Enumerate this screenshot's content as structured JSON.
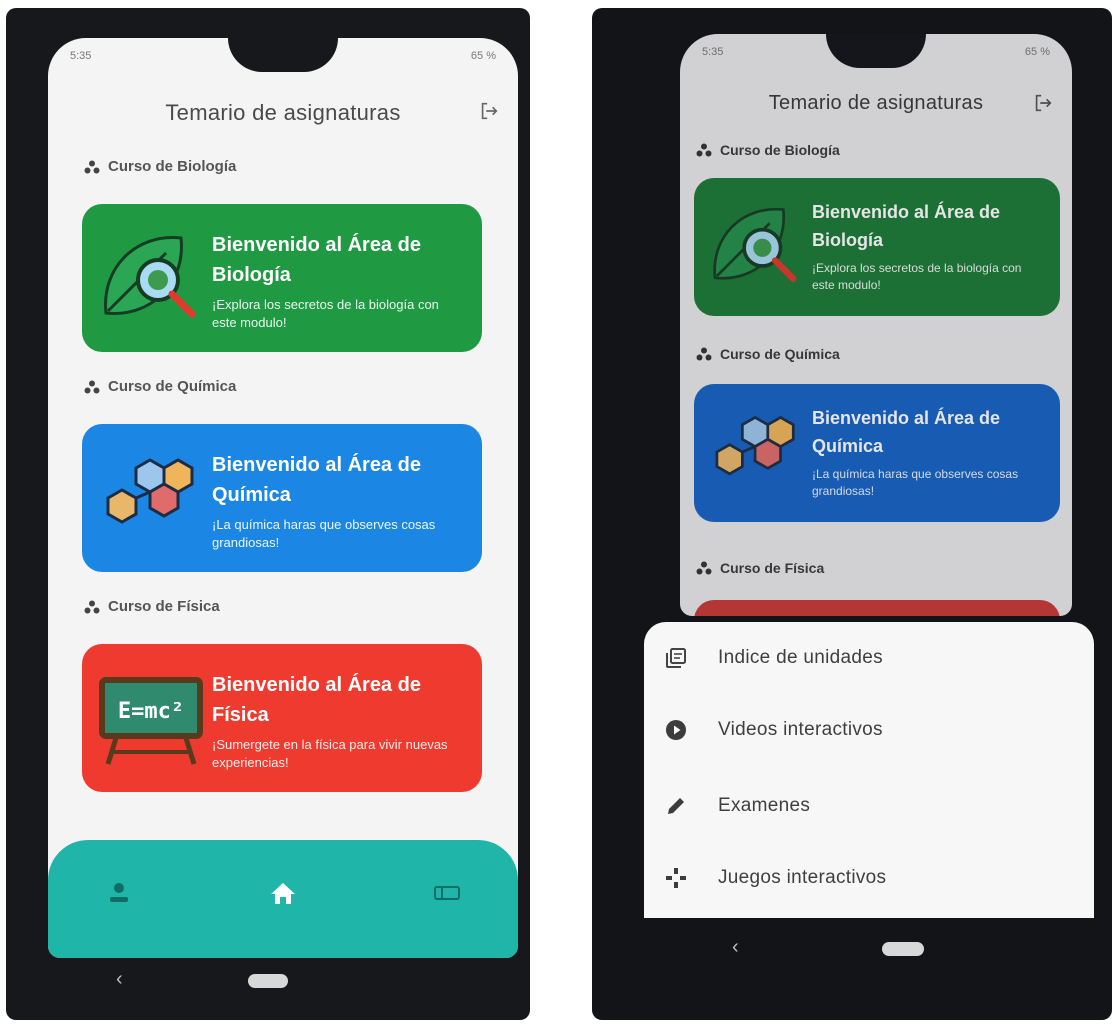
{
  "status_bar": {
    "time": "5:35",
    "battery": "65 %"
  },
  "header": {
    "title": "Temario de asignaturas"
  },
  "sections": [
    {
      "label": "Curso de Biología",
      "card": {
        "title": "Bienvenido al Área de Biología",
        "subtitle": "¡Explora los secretos de la biología con este modulo!",
        "color": "#1f9a43"
      }
    },
    {
      "label": "Curso de Química",
      "card": {
        "title": "Bienvenido al Área de Química",
        "subtitle": "¡La química haras que observes cosas grandiosas!",
        "color": "#1c86e4"
      }
    },
    {
      "label": "Curso de Física",
      "card": {
        "title": "Bienvenido al Área de Física",
        "subtitle": "¡Sumergete en la física para vivir nuevas experiencias!",
        "color": "#ee3a2f",
        "art_text": "E=mc²"
      }
    }
  ],
  "bottom_nav": {
    "items": [
      "person-icon",
      "home-icon",
      "ticket-icon"
    ],
    "color": "#1fb5a8"
  },
  "sheet": {
    "items": [
      {
        "label": "Indice de unidades",
        "icon": "library-icon"
      },
      {
        "label": "Videos interactivos",
        "icon": "play-circle-icon"
      },
      {
        "label": "Examenes",
        "icon": "pencil-icon"
      },
      {
        "label": "Juegos interactivos",
        "icon": "gamepad-icon"
      }
    ]
  }
}
